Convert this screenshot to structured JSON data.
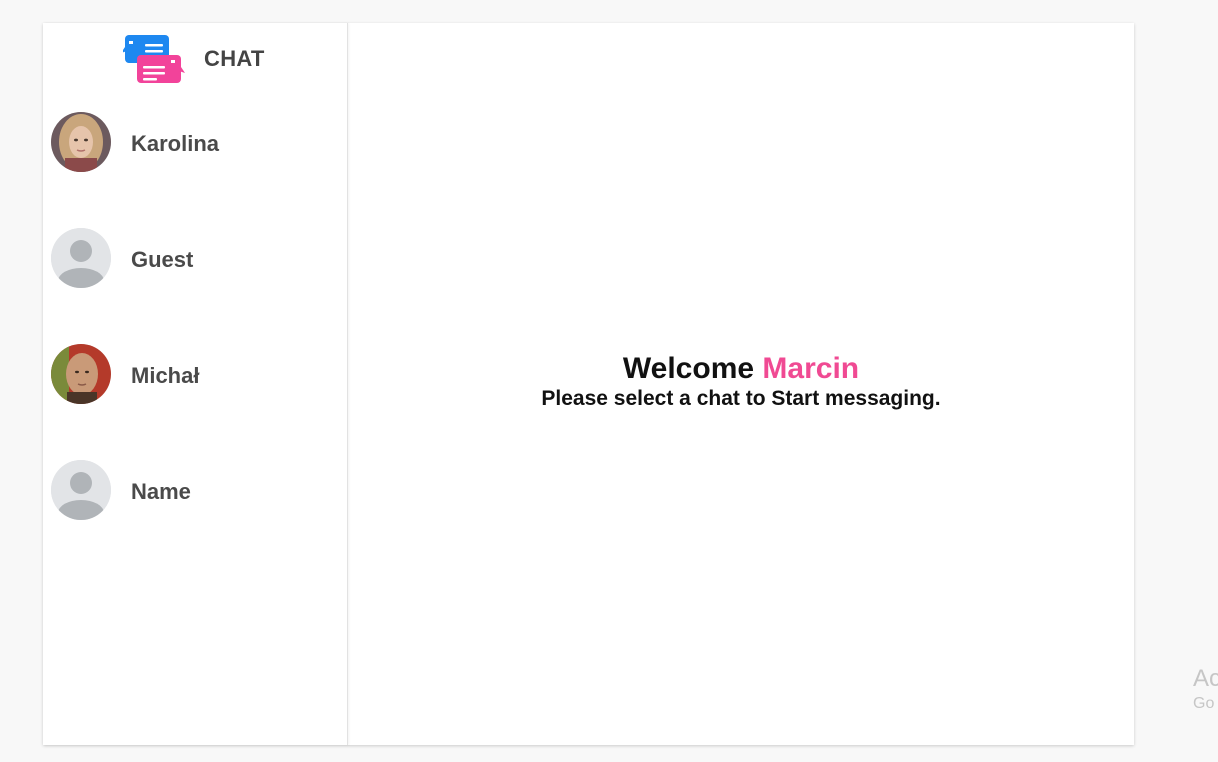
{
  "brand": {
    "title": "CHAT",
    "logo_icon": "chat-bubbles-icon",
    "colors": {
      "blue": "#1e88f0",
      "pink": "#f2439a"
    }
  },
  "contacts": [
    {
      "name": "Karolina",
      "avatar": "photo-woman-blonde"
    },
    {
      "name": "Guest",
      "avatar": "default-user-icon"
    },
    {
      "name": "Michał",
      "avatar": "photo-man-bald"
    },
    {
      "name": "Name",
      "avatar": "default-user-icon"
    }
  ],
  "welcome": {
    "prefix": "Welcome",
    "user_name": "Marcin",
    "subtitle": "Please select a chat to Start messaging.",
    "accent_color": "#f04a93"
  },
  "watermark": {
    "line1": "Ac",
    "line2": "Go"
  }
}
